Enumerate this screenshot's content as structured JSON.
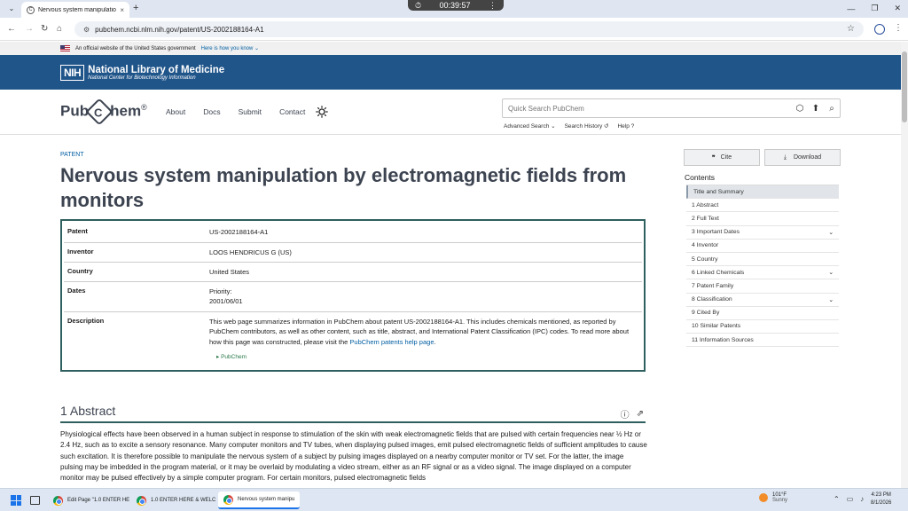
{
  "browser": {
    "tab_title": "Nervous system manipulation b",
    "tab_close": "×",
    "new_tab": "+",
    "timer": "00:39:57",
    "url": "pubchem.ncbi.nlm.nih.gov/patent/US-2002188164-A1"
  },
  "gov_banner": {
    "text": "An official website of the United States government",
    "link": "Here is how you know"
  },
  "nlm": {
    "logo": "NIH",
    "title": "National Library of Medicine",
    "subtitle": "National Center for Biotechnology Information"
  },
  "pubchem": {
    "logo_left": "Pub",
    "logo_c": "C",
    "logo_right": "hem",
    "logo_reg": "®",
    "nav": [
      "About",
      "Docs",
      "Submit",
      "Contact"
    ],
    "search_placeholder": "Quick Search PubChem",
    "search_links": [
      "Advanced Search",
      "Search History",
      "Help"
    ]
  },
  "patent": {
    "label": "PATENT",
    "title": "Nervous system manipulation by electromagnetic fields from monitors",
    "rows": [
      {
        "key": "Patent",
        "value": "US-2002188164-A1"
      },
      {
        "key": "Inventor",
        "value": "LOOS HENDRICUS G (US)"
      },
      {
        "key": "Country",
        "value": "United States"
      },
      {
        "key": "Dates",
        "value_line1": "Priority:",
        "value_line2": "2001/06/01"
      },
      {
        "key": "Description",
        "value": "This web page summarizes information in PubChem about patent US-2002188164-A1. This includes chemicals mentioned, as reported by PubChem contributors, as well as other content, such as title, abstract, and International Patent Classification (IPC) codes. To read more about how this page was constructed, please visit the ",
        "link": "PubChem patents help page",
        "end": ".",
        "toggle": "PubChem"
      }
    ]
  },
  "abstract": {
    "heading": "1 Abstract",
    "text": "Physiological effects have been observed in a human subject in response to stimulation of the skin with weak electromagnetic fields that are pulsed with certain frequencies near ½ Hz or 2.4 Hz, such as to excite a sensory resonance. Many computer monitors and TV tubes, when displaying pulsed images, emit pulsed electromagnetic fields of sufficient amplitudes to cause such excitation. It is therefore possible to manipulate the nervous system of a subject by pulsing images displayed on a nearby computer monitor or TV set. For the latter, the image pulsing may be imbedded in the program material, or it may be overlaid by modulating a video stream, either as an RF signal or as a video signal. The image displayed on a computer monitor may be pulsed effectively by a simple computer program. For certain monitors, pulsed electromagnetic fields"
  },
  "sidebar": {
    "cite": "Cite",
    "download": "Download",
    "contents_title": "Contents",
    "toc": [
      {
        "label": "Title and Summary",
        "expand": false
      },
      {
        "label": "1 Abstract",
        "expand": false
      },
      {
        "label": "2 Full Text",
        "expand": false
      },
      {
        "label": "3 Important Dates",
        "expand": true
      },
      {
        "label": "4 Inventor",
        "expand": false
      },
      {
        "label": "5 Country",
        "expand": false
      },
      {
        "label": "6 Linked Chemicals",
        "expand": true
      },
      {
        "label": "7 Patent Family",
        "expand": false
      },
      {
        "label": "8 Classification",
        "expand": true
      },
      {
        "label": "9 Cited By",
        "expand": false
      },
      {
        "label": "10 Similar Patents",
        "expand": false
      },
      {
        "label": "11 Information Sources",
        "expand": false
      }
    ]
  },
  "taskbar": {
    "tasks": [
      "Edit Page \"1.0 ENTER HE",
      "1.0 ENTER HERE & WELC",
      "Nervous system manipu"
    ],
    "weather_temp": "101°F",
    "weather_desc": "Sunny",
    "time": "4:23 PM",
    "date": "8/1/2026"
  }
}
